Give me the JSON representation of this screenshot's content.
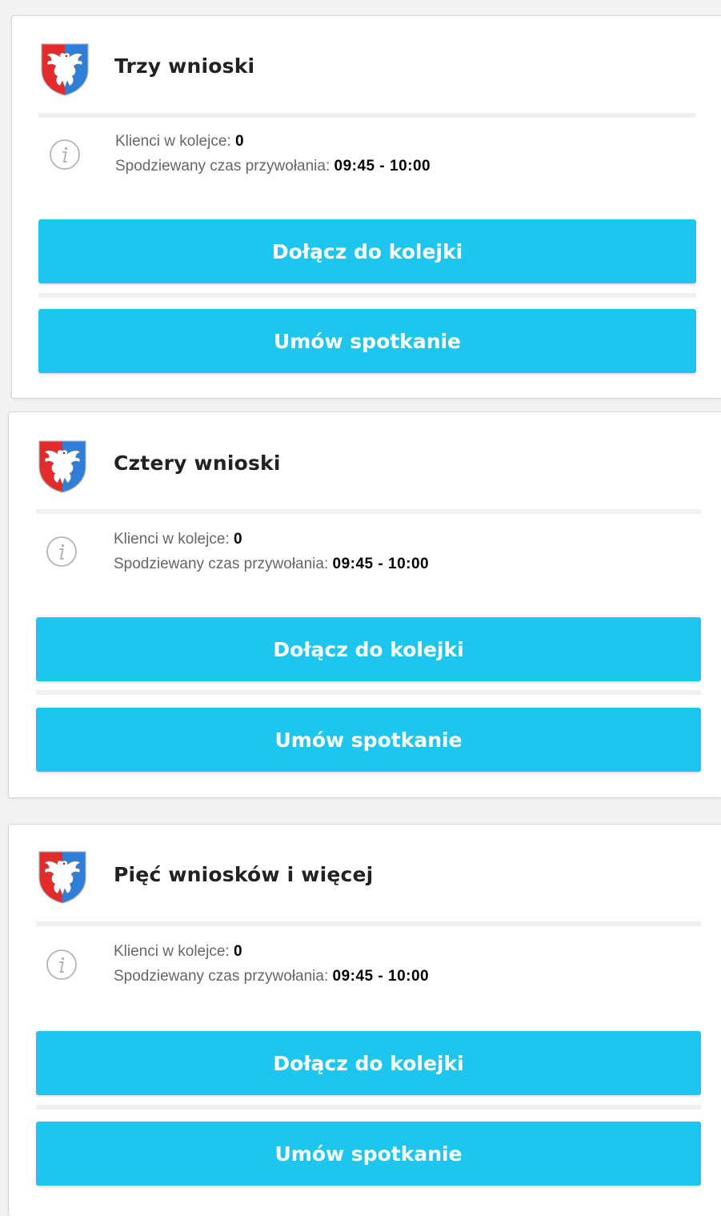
{
  "labels": {
    "queue_label": "Klienci w kolejce:",
    "time_label": "Spodziewany czas przywołania:",
    "join_button": "Dołącz do kolejki",
    "appointment_button": "Umów spotkanie"
  },
  "services": [
    {
      "title": "Trzy wnioski",
      "queue_count": "0",
      "expected_time": "09:45 - 10:00"
    },
    {
      "title": "Cztery wnioski",
      "queue_count": "0",
      "expected_time": "09:45 - 10:00"
    },
    {
      "title": "Pięć wniosków i więcej",
      "queue_count": "0",
      "expected_time": "09:45 - 10:00"
    }
  ],
  "icons": {
    "crest": "coat-of-arms-icon",
    "info": "info-icon"
  },
  "colors": {
    "button": "#1ec6ee",
    "button_text": "#ffffff",
    "background": "#f2f2f2"
  }
}
